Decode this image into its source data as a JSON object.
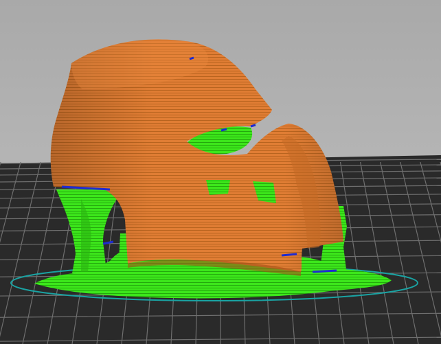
{
  "viewport": {
    "background_top": "#a9a9a9",
    "background_bottom": "#bdbdbd",
    "bed_color": "#2a2a2a",
    "bed_grid_color": "#6f6f6f",
    "skirt_color": "#1aa3a3"
  },
  "model": {
    "perimeter_color": "#e07d34",
    "perimeter_shadow": "#b8601f",
    "support_color": "#3ce61b",
    "support_shadow": "#25a80e",
    "bridge_color": "#1e2bd1"
  }
}
